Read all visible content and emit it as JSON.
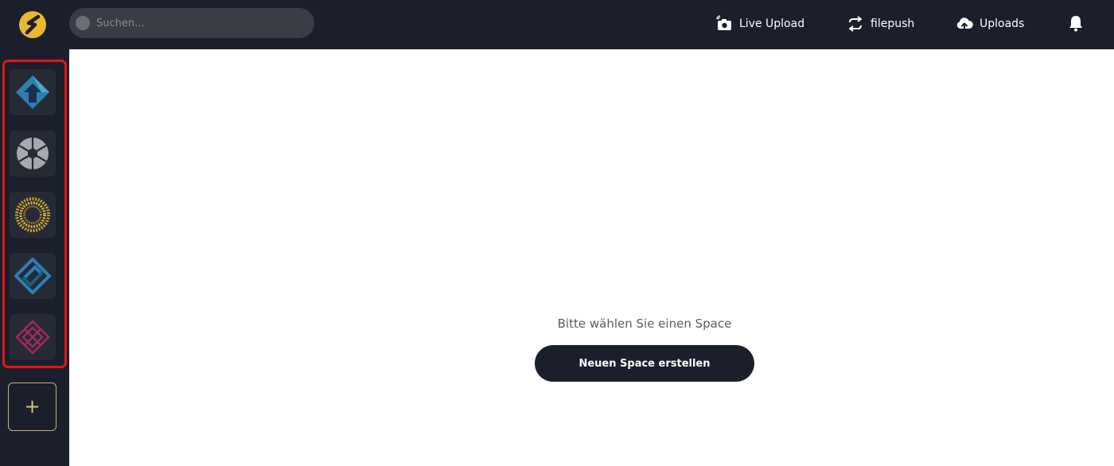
{
  "search": {
    "placeholder": "Suchen..."
  },
  "nav": {
    "live_upload": "Live Upload",
    "filepush": "filepush",
    "uploads": "Uploads"
  },
  "sidebar": {
    "spaces": [
      {
        "icon": "blue-arrow-diamond-icon"
      },
      {
        "icon": "gray-aperture-icon"
      },
      {
        "icon": "gold-dotted-sun-icon"
      },
      {
        "icon": "blue-interlocked-diamond-icon"
      },
      {
        "icon": "magenta-diamond-grid-icon"
      }
    ],
    "add_label": "+"
  },
  "main": {
    "prompt": "Bitte wählen Sie einen Space",
    "create_button": "Neuen Space erstellen"
  },
  "colors": {
    "topbar": "#1b1f2b",
    "accent_gold": "#e8b830",
    "highlight_red": "#e4141b"
  }
}
